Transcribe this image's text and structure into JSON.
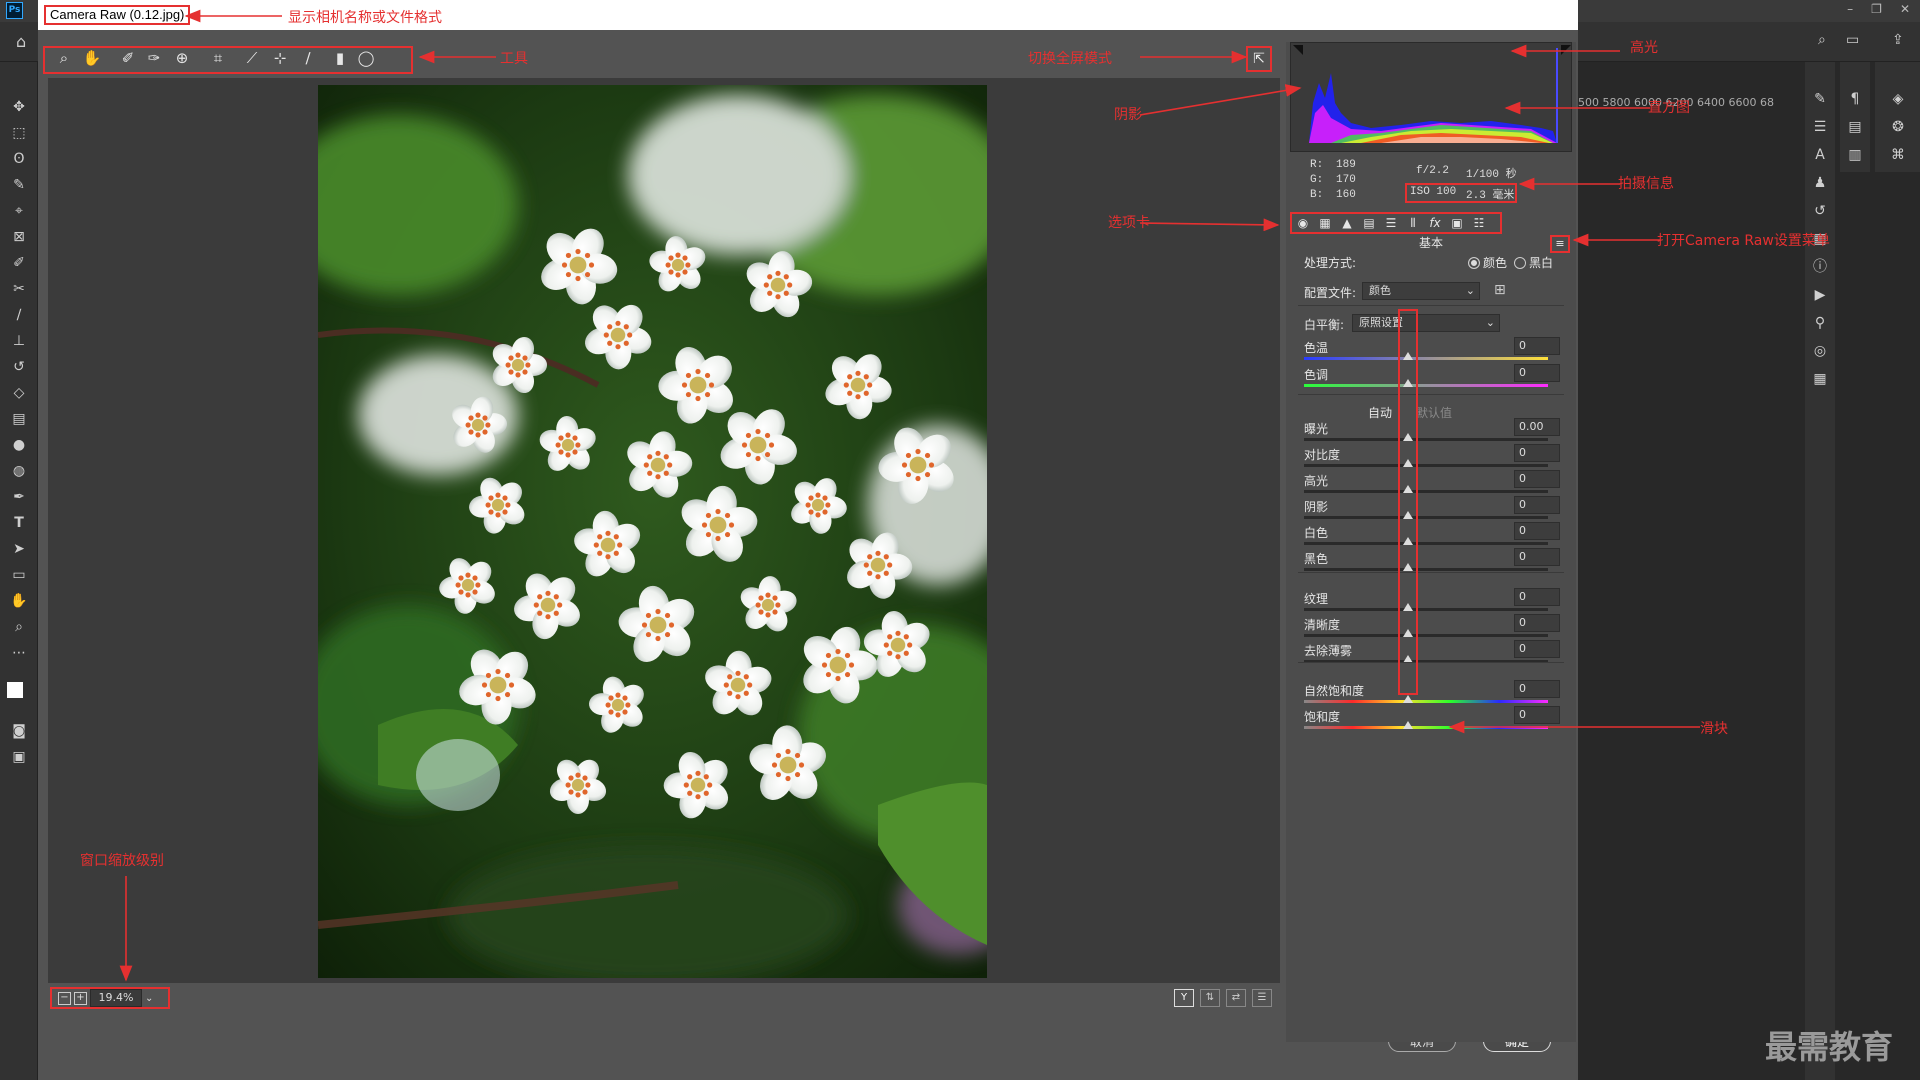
{
  "window": {
    "title": "Camera Raw (0.12.jpg)",
    "ps_logo": "Ps",
    "min": "–",
    "max": "❐",
    "close": "✕"
  },
  "ps_ruler": "500 5800 6000 6200 6400 6600 68",
  "histogram": {
    "r_label": "R:",
    "g_label": "G:",
    "b_label": "B:",
    "r": "189",
    "g": "170",
    "b": "160",
    "aperture": "f/2.2",
    "shutter": "1/100 秒",
    "iso": "ISO 100",
    "focal": "2.3 毫米"
  },
  "panel": {
    "section": "基本",
    "process_label": "处理方式:",
    "process_color": "颜色",
    "process_bw": "黑白",
    "profile_label": "配置文件:",
    "profile_value": "颜色",
    "wb_label": "白平衡:",
    "wb_value": "原照设置",
    "auto": "自动",
    "default": "默认值",
    "sliders": [
      {
        "label": "色温",
        "value": "0"
      },
      {
        "label": "色调",
        "value": "0"
      },
      {
        "label": "曝光",
        "value": "0.00"
      },
      {
        "label": "对比度",
        "value": "0"
      },
      {
        "label": "高光",
        "value": "0"
      },
      {
        "label": "阴影",
        "value": "0"
      },
      {
        "label": "白色",
        "value": "0"
      },
      {
        "label": "黑色",
        "value": "0"
      },
      {
        "label": "纹理",
        "value": "0"
      },
      {
        "label": "清晰度",
        "value": "0"
      },
      {
        "label": "去除薄雾",
        "value": "0"
      },
      {
        "label": "自然饱和度",
        "value": "0"
      },
      {
        "label": "饱和度",
        "value": "0"
      }
    ]
  },
  "zoom": "19.4%",
  "buttons": {
    "cancel": "取消",
    "ok": "确定"
  },
  "annotations": {
    "title": "显示相机名称或文件格式",
    "tools": "工具",
    "fullscreen": "切换全屏模式",
    "highlight": "高光",
    "shadow": "阴影",
    "histogram": "直方图",
    "shot_info": "拍摄信息",
    "tabs": "选项卡",
    "settings_menu": "打开Camera Raw设置菜单",
    "slider": "滑块",
    "zoom_level": "窗口缩放级别"
  },
  "watermark": "最需教育",
  "colors": {
    "annotation_red": "#e53030",
    "dialog_bg": "#535353",
    "preview_bg": "#3b3b3b"
  }
}
